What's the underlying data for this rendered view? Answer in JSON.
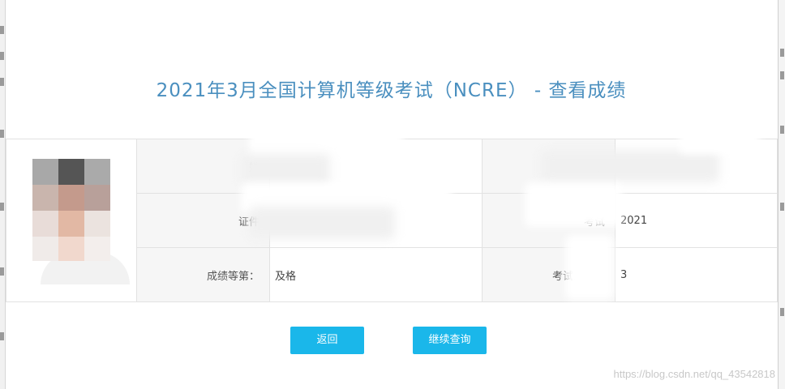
{
  "dialog": {
    "title": "2021年3月全国计算机等级考试（NCRE） - 查看成绩"
  },
  "results": {
    "rows": [
      {
        "left_label": "姓",
        "left_value": "",
        "right_label": "准",
        "right_value": ""
      },
      {
        "left_label": "证件",
        "left_value": "",
        "right_label": "考试",
        "right_value": "2021"
      },
      {
        "left_label": "成绩等第：",
        "left_value": "及格",
        "right_label": "考试月份：",
        "right_value": "3"
      }
    ]
  },
  "buttons": {
    "back_label": "返回",
    "continue_label": "继续查询"
  },
  "watermark": "https://blog.csdn.net/qq_43542818",
  "colors": {
    "title": "#4a8fbf",
    "button": "#1ab7ea",
    "label_bg": "#f6f6f6",
    "border": "#e2e2e2"
  }
}
